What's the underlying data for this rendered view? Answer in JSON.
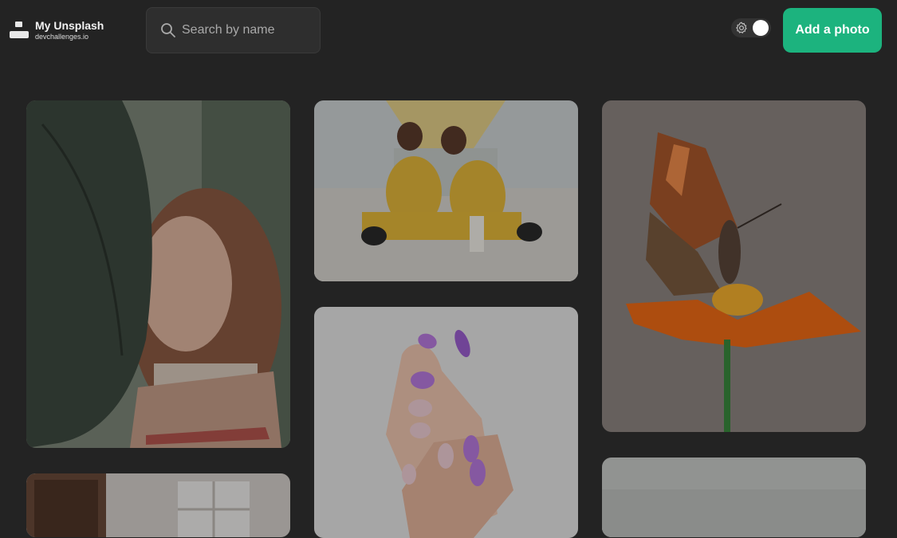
{
  "header": {
    "logo_title": "My Unsplash",
    "logo_subtitle": "devchallenges.io",
    "search_placeholder": "Search by name",
    "add_button_label": "Add a photo"
  },
  "colors": {
    "background": "#232323",
    "accent": "#1cb37e"
  },
  "icons": [
    "logo-icon",
    "search-icon",
    "gear-icon"
  ],
  "gallery": {
    "photos": [
      {
        "name": "woman-with-leaf-photo",
        "subject": "woman behind large leaf"
      },
      {
        "name": "two-people-sitting-photo",
        "subject": "two people in yellow sitting under tunnel"
      },
      {
        "name": "butterfly-on-flower-photo",
        "subject": "butterfly on orange flower"
      },
      {
        "name": "room-window-photo",
        "subject": "room with window"
      },
      {
        "name": "purple-nails-photo",
        "subject": "hands with purple nails"
      },
      {
        "name": "grey-landscape-photo",
        "subject": "grey sky"
      }
    ]
  }
}
